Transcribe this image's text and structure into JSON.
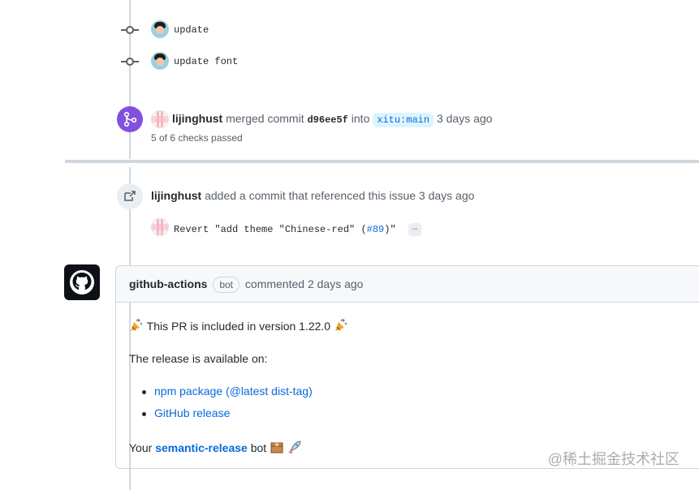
{
  "commits": [
    {
      "message": "update"
    },
    {
      "message": "update font"
    }
  ],
  "merge_event": {
    "user": "lijinghust",
    "action": "merged commit",
    "sha": "d96ee5f",
    "into": "into",
    "branch": "xitu:main",
    "time": "3 days ago",
    "checks": "5 of 6 checks passed"
  },
  "reference_event": {
    "user": "lijinghust",
    "text": "added a commit that referenced this issue 3 days ago",
    "commit_message_prefix": "Revert \"add theme \"Chinese-red\" (",
    "issue_ref": "#89",
    "commit_message_suffix": ")\"",
    "ellipsis": "…"
  },
  "comment": {
    "author": "github-actions",
    "badge": "bot",
    "meta": "commented 2 days ago",
    "line1": "This PR is included in version 1.22.0",
    "line2": "The release is available on:",
    "links": [
      "npm package (@latest dist-tag)",
      "GitHub release"
    ],
    "footer_prefix": "Your",
    "footer_link": "semantic-release",
    "footer_suffix": "bot"
  },
  "watermark": "@稀土掘金技术社区",
  "colors": {
    "merge_purple": "#8250df",
    "link_blue": "#0969da",
    "border": "#d0d7de"
  },
  "icons": [
    "commit-icon",
    "merge-icon",
    "cross-reference-icon",
    "github-logo-icon",
    "party-popper-icon",
    "package-icon",
    "rocket-icon"
  ]
}
